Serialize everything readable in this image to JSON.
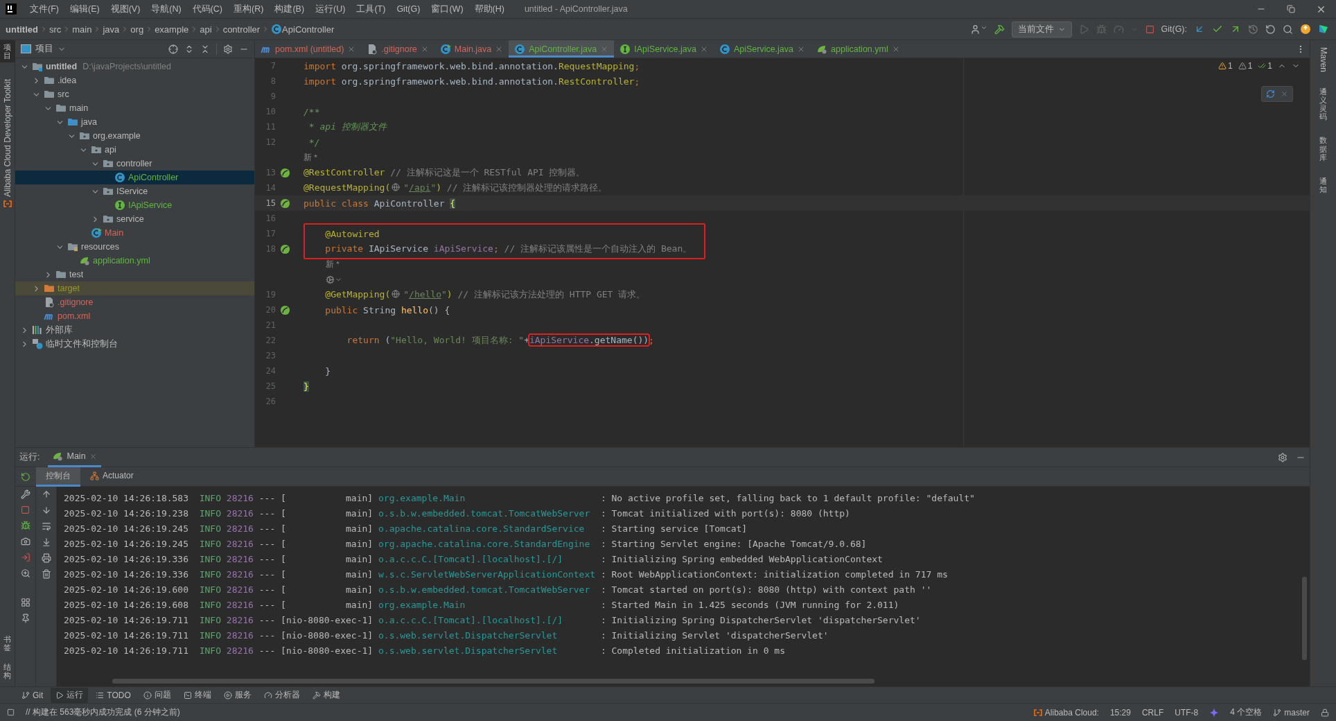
{
  "title_bar": {
    "menu": [
      "文件(F)",
      "编辑(E)",
      "视图(V)",
      "导航(N)",
      "代码(C)",
      "重构(R)",
      "构建(B)",
      "运行(U)",
      "工具(T)",
      "Git(G)",
      "窗口(W)",
      "帮助(H)"
    ],
    "title": "untitled - ApiController.java"
  },
  "nav_bar": {
    "breadcrumbs": [
      {
        "label": "untitled",
        "kind": "project"
      },
      {
        "label": "src",
        "kind": "dir"
      },
      {
        "label": "main",
        "kind": "dir"
      },
      {
        "label": "java",
        "kind": "dir"
      },
      {
        "label": "org",
        "kind": "dir"
      },
      {
        "label": "example",
        "kind": "dir"
      },
      {
        "label": "api",
        "kind": "dir"
      },
      {
        "label": "controller",
        "kind": "dir"
      },
      {
        "label": "ApiController",
        "kind": "class"
      }
    ],
    "run_config": "当前文件",
    "git_label": "Git(G):"
  },
  "left_strip": {
    "top": [
      {
        "label": "项目",
        "selected": true
      }
    ],
    "plugin": "Alibaba Cloud Developer Toolkit",
    "bottom": [
      {
        "label": "书签"
      },
      {
        "label": "结构"
      }
    ]
  },
  "right_strip": [
    {
      "label": "Maven",
      "kind": "latin"
    },
    {
      "label": "通义灵码",
      "kind": "cjk"
    },
    {
      "label": "数据库",
      "kind": "cjk"
    },
    {
      "label": "通知",
      "kind": "cjk"
    }
  ],
  "project": {
    "title": "项目",
    "tree": [
      {
        "label": "untitled",
        "kind": "module",
        "path": "D:\\javaProjects\\untitled",
        "expanded": true,
        "selected": false,
        "children": [
          {
            "label": ".idea",
            "kind": "folder",
            "expanded": false,
            "selected": false
          },
          {
            "label": "src",
            "kind": "folder",
            "expanded": true,
            "selected": false,
            "children": [
              {
                "label": "main",
                "kind": "folder",
                "expanded": true,
                "selected": false,
                "children": [
                  {
                    "label": "java",
                    "kind": "source",
                    "expanded": true,
                    "selected": false,
                    "children": [
                      {
                        "label": "org.example",
                        "kind": "package",
                        "expanded": true,
                        "selected": false,
                        "children": [
                          {
                            "label": "api",
                            "kind": "package",
                            "expanded": true,
                            "selected": false,
                            "children": [
                              {
                                "label": "controller",
                                "kind": "package",
                                "expanded": true,
                                "selected": false,
                                "children": [
                                  {
                                    "label": "ApiController",
                                    "kind": "class",
                                    "color": "#62b543",
                                    "selected": true
                                  }
                                ]
                              },
                              {
                                "label": "IService",
                                "kind": "package",
                                "expanded": true,
                                "selected": false,
                                "children": [
                                  {
                                    "label": "IApiService",
                                    "kind": "interface",
                                    "color": "#62b543",
                                    "selected": false
                                  }
                                ]
                              },
                              {
                                "label": "service",
                                "kind": "package",
                                "expanded": false,
                                "selected": false
                              }
                            ]
                          },
                          {
                            "label": "Main",
                            "kind": "main-class",
                            "color": "#d1675a",
                            "selected": false
                          }
                        ]
                      }
                    ]
                  },
                  {
                    "label": "resources",
                    "kind": "resources",
                    "expanded": true,
                    "selected": false,
                    "children": [
                      {
                        "label": "application.yml",
                        "kind": "yaml",
                        "color": "#62b543",
                        "selected": false
                      }
                    ]
                  }
                ]
              },
              {
                "label": "test",
                "kind": "folder",
                "expanded": false,
                "selected": false
              }
            ]
          },
          {
            "label": "target",
            "kind": "excluded",
            "color": "#9a9a22",
            "expanded": false,
            "selected": false
          },
          {
            "label": ".gitignore",
            "kind": "gitignore",
            "color": "#d1675a",
            "selected": false
          },
          {
            "label": "pom.xml",
            "kind": "maven",
            "color": "#d1675a",
            "selected": false
          }
        ]
      },
      {
        "label": "外部库",
        "kind": "library",
        "expanded": false,
        "selected": false
      },
      {
        "label": "临时文件和控制台",
        "kind": "scratch",
        "expanded": false,
        "selected": false
      }
    ]
  },
  "editor": {
    "tabs": [
      {
        "label": "pom.xml (untitled)",
        "kind": "maven",
        "color": "#d1675a",
        "selected": false
      },
      {
        "label": ".gitignore",
        "kind": "gitignore",
        "color": "#d1675a",
        "selected": false
      },
      {
        "label": "Main.java",
        "kind": "main-class",
        "color": "#d1675a",
        "selected": false
      },
      {
        "label": "ApiController.java",
        "kind": "class",
        "color": "#62b543",
        "selected": true
      },
      {
        "label": "IApiService.java",
        "kind": "interface",
        "color": "#62b543",
        "selected": false
      },
      {
        "label": "ApiService.java",
        "kind": "class",
        "color": "#62b543",
        "selected": false
      },
      {
        "label": "application.yml",
        "kind": "yaml",
        "color": "#62b543",
        "selected": false
      }
    ],
    "inspections": [
      {
        "kind": "warning",
        "count": "1"
      },
      {
        "kind": "weak",
        "count": "1"
      },
      {
        "kind": "ok",
        "count": "1"
      }
    ],
    "lines": [
      {
        "kind": "code",
        "n": "7",
        "segs": [
          {
            "t": "import",
            "kind": "kw"
          },
          {
            "t": " org.springframework.web.bind.annotation.",
            "kind": "plain"
          },
          {
            "t": "RequestMapping",
            "kind": "ann"
          },
          {
            "t": ";",
            "kind": "kw"
          }
        ]
      },
      {
        "kind": "code",
        "n": "8",
        "segs": [
          {
            "t": "import",
            "kind": "kw"
          },
          {
            "t": " org.springframework.web.bind.annotation.",
            "kind": "plain"
          },
          {
            "t": "RestController",
            "kind": "ann"
          },
          {
            "t": ";",
            "kind": "kw"
          }
        ]
      },
      {
        "kind": "code",
        "n": "9"
      },
      {
        "kind": "code",
        "n": "10",
        "segs": [
          {
            "t": "/**",
            "kind": "doc"
          }
        ]
      },
      {
        "kind": "code",
        "n": "11",
        "segs": [
          {
            "t": " * api 控制器文件",
            "kind": "doc"
          }
        ]
      },
      {
        "kind": "code",
        "n": "12",
        "segs": [
          {
            "t": " */",
            "kind": "doc"
          }
        ]
      },
      {
        "kind": "inlay",
        "text": "新 *"
      },
      {
        "kind": "code",
        "n": "13",
        "marker": true,
        "segs": [
          {
            "t": "@RestController",
            "kind": "ann"
          },
          {
            "t": " // 注解标记这是一个 RESTful API 控制器。",
            "kind": "cmt"
          }
        ]
      },
      {
        "kind": "code",
        "n": "14",
        "segs": [
          {
            "t": "@RequestMapping(",
            "kind": "ann"
          },
          {
            "kind": "icon"
          },
          {
            "t": "\"",
            "kind": "str"
          },
          {
            "t": "/api",
            "kind": "url"
          },
          {
            "t": "\"",
            "kind": "str"
          },
          {
            "t": ")",
            "kind": "ann"
          },
          {
            "t": " // 注解标记该控制器处理的请求路径。",
            "kind": "cmt"
          }
        ]
      },
      {
        "kind": "code",
        "n": "15",
        "marker": true,
        "current": true,
        "segs": [
          {
            "t": "public class ",
            "kind": "kw"
          },
          {
            "t": "ApiController ",
            "kind": "plain"
          },
          {
            "t": "{",
            "kind": "brace"
          }
        ]
      },
      {
        "kind": "code",
        "n": "16"
      },
      {
        "kind": "code",
        "n": "17",
        "boxed": true,
        "segs": [
          {
            "t": "    @Autowired",
            "kind": "ann"
          }
        ]
      },
      {
        "kind": "code",
        "n": "18",
        "boxed": true,
        "marker": true,
        "segs": [
          {
            "t": "    private ",
            "kind": "kw"
          },
          {
            "t": "IApiService ",
            "kind": "plain"
          },
          {
            "t": "iApiService",
            "kind": "field"
          },
          {
            "t": ";",
            "kind": "kw"
          },
          {
            "t": " // 注解标记该属性是一个自动注入的 Bean。",
            "kind": "cmt"
          }
        ]
      },
      {
        "kind": "inlay",
        "text": "新 *"
      },
      {
        "kind": "inlay-icon"
      },
      {
        "kind": "code",
        "n": "19",
        "segs": [
          {
            "t": "    @GetMapping(",
            "kind": "ann"
          },
          {
            "kind": "icon"
          },
          {
            "t": "\"",
            "kind": "str"
          },
          {
            "t": "/hello",
            "kind": "url"
          },
          {
            "t": "\"",
            "kind": "str"
          },
          {
            "t": ")",
            "kind": "ann"
          },
          {
            "t": " // 注解标记该方法处理的 HTTP GET 请求。",
            "kind": "cmt"
          }
        ]
      },
      {
        "kind": "code",
        "n": "20",
        "marker": true,
        "segs": [
          {
            "t": "    public ",
            "kind": "kw"
          },
          {
            "t": "String ",
            "kind": "plain"
          },
          {
            "t": "hello",
            "kind": "method"
          },
          {
            "t": "() {",
            "kind": "plain"
          }
        ]
      },
      {
        "kind": "code",
        "n": "21"
      },
      {
        "kind": "code",
        "n": "22",
        "segs": [
          {
            "t": "        return ",
            "kind": "kw"
          },
          {
            "t": "(",
            "kind": "plain"
          },
          {
            "t": "\"Hello, World! 项目名称: \"",
            "kind": "str"
          },
          {
            "t": "+",
            "kind": "plain"
          },
          {
            "t": "iApiService",
            "kind": "field",
            "boxed": true
          },
          {
            "t": ".getName()",
            "kind": "plain",
            "boxed": true
          },
          {
            "t": ")",
            "kind": "plain",
            "boxed": true
          },
          {
            "t": ";",
            "kind": "kw"
          }
        ]
      },
      {
        "kind": "code",
        "n": "23"
      },
      {
        "kind": "code",
        "n": "24",
        "segs": [
          {
            "t": "    }",
            "kind": "plain"
          }
        ]
      },
      {
        "kind": "code",
        "n": "25",
        "segs": [
          {
            "t": "}",
            "kind": "brace"
          }
        ]
      },
      {
        "kind": "code",
        "n": "26"
      }
    ]
  },
  "run": {
    "label": "运行:",
    "tabs": [
      {
        "label": "Main",
        "selected": true
      }
    ],
    "subtabs": [
      {
        "label": "控制台",
        "kind": "console",
        "selected": true
      },
      {
        "label": "Actuator",
        "kind": "actuator",
        "selected": false
      }
    ],
    "log": [
      {
        "time": "2025-02-10 14:26:18.583",
        "severity": "INFO",
        "pid": "28216",
        "sep": "---",
        "thread": "[           main]",
        "logger": "org.example.Main",
        "message": ": No active profile set, falling back to 1 default profile: \"default\""
      },
      {
        "time": "2025-02-10 14:26:19.238",
        "severity": "INFO",
        "pid": "28216",
        "sep": "---",
        "thread": "[           main]",
        "logger": "o.s.b.w.embedded.tomcat.TomcatWebServer",
        "message": ": Tomcat initialized with port(s): 8080 (http)"
      },
      {
        "time": "2025-02-10 14:26:19.245",
        "severity": "INFO",
        "pid": "28216",
        "sep": "---",
        "thread": "[           main]",
        "logger": "o.apache.catalina.core.StandardService",
        "message": ": Starting service [Tomcat]"
      },
      {
        "time": "2025-02-10 14:26:19.245",
        "severity": "INFO",
        "pid": "28216",
        "sep": "---",
        "thread": "[           main]",
        "logger": "org.apache.catalina.core.StandardEngine",
        "message": ": Starting Servlet engine: [Apache Tomcat/9.0.68]"
      },
      {
        "time": "2025-02-10 14:26:19.336",
        "severity": "INFO",
        "pid": "28216",
        "sep": "---",
        "thread": "[           main]",
        "logger": "o.a.c.c.C.[Tomcat].[localhost].[/]",
        "message": ": Initializing Spring embedded WebApplicationContext"
      },
      {
        "time": "2025-02-10 14:26:19.336",
        "severity": "INFO",
        "pid": "28216",
        "sep": "---",
        "thread": "[           main]",
        "logger": "w.s.c.ServletWebServerApplicationContext",
        "message": ": Root WebApplicationContext: initialization completed in 717 ms"
      },
      {
        "time": "2025-02-10 14:26:19.600",
        "severity": "INFO",
        "pid": "28216",
        "sep": "---",
        "thread": "[           main]",
        "logger": "o.s.b.w.embedded.tomcat.TomcatWebServer",
        "message": ": Tomcat started on port(s): 8080 (http) with context path ''"
      },
      {
        "time": "2025-02-10 14:26:19.608",
        "severity": "INFO",
        "pid": "28216",
        "sep": "---",
        "thread": "[           main]",
        "logger": "org.example.Main",
        "message": ": Started Main in 1.425 seconds (JVM running for 2.011)"
      },
      {
        "time": "2025-02-10 14:26:19.711",
        "severity": "INFO",
        "pid": "28216",
        "sep": "---",
        "thread": "[nio-8080-exec-1]",
        "logger": "o.a.c.c.C.[Tomcat].[localhost].[/]",
        "message": ": Initializing Spring DispatcherServlet 'dispatcherServlet'"
      },
      {
        "time": "2025-02-10 14:26:19.711",
        "severity": "INFO",
        "pid": "28216",
        "sep": "---",
        "thread": "[nio-8080-exec-1]",
        "logger": "o.s.web.servlet.DispatcherServlet",
        "message": ": Initializing Servlet 'dispatcherServlet'"
      },
      {
        "time": "2025-02-10 14:26:19.711",
        "severity": "INFO",
        "pid": "28216",
        "sep": "---",
        "thread": "[nio-8080-exec-1]",
        "logger": "o.s.web.servlet.DispatcherServlet",
        "message": ": Completed initialization in 0 ms"
      }
    ]
  },
  "tool_windows": [
    {
      "label": "Git",
      "kind": "git",
      "selected": false
    },
    {
      "label": "运行",
      "kind": "run",
      "selected": true
    },
    {
      "label": "TODO",
      "kind": "todo",
      "selected": false
    },
    {
      "label": "问题",
      "kind": "problems",
      "selected": false
    },
    {
      "label": "终端",
      "kind": "terminal",
      "selected": false
    },
    {
      "label": "服务",
      "kind": "services",
      "selected": false
    },
    {
      "label": "分析器",
      "kind": "profiler",
      "selected": false
    },
    {
      "label": "构建",
      "kind": "build",
      "selected": false
    }
  ],
  "status_bar": {
    "message": "// 构建在 563毫秒内成功完成 (6 分钟之前)",
    "items": [
      {
        "label": "Alibaba Cloud:",
        "kind": "alibaba"
      },
      {
        "label": "15:29",
        "kind": "text"
      },
      {
        "label": "CRLF",
        "kind": "text"
      },
      {
        "label": "UTF-8",
        "kind": "text"
      },
      {
        "kind": "ai"
      },
      {
        "label": "4 个空格",
        "kind": "text"
      },
      {
        "label": "master",
        "kind": "branch"
      },
      {
        "kind": "lock"
      }
    ]
  }
}
